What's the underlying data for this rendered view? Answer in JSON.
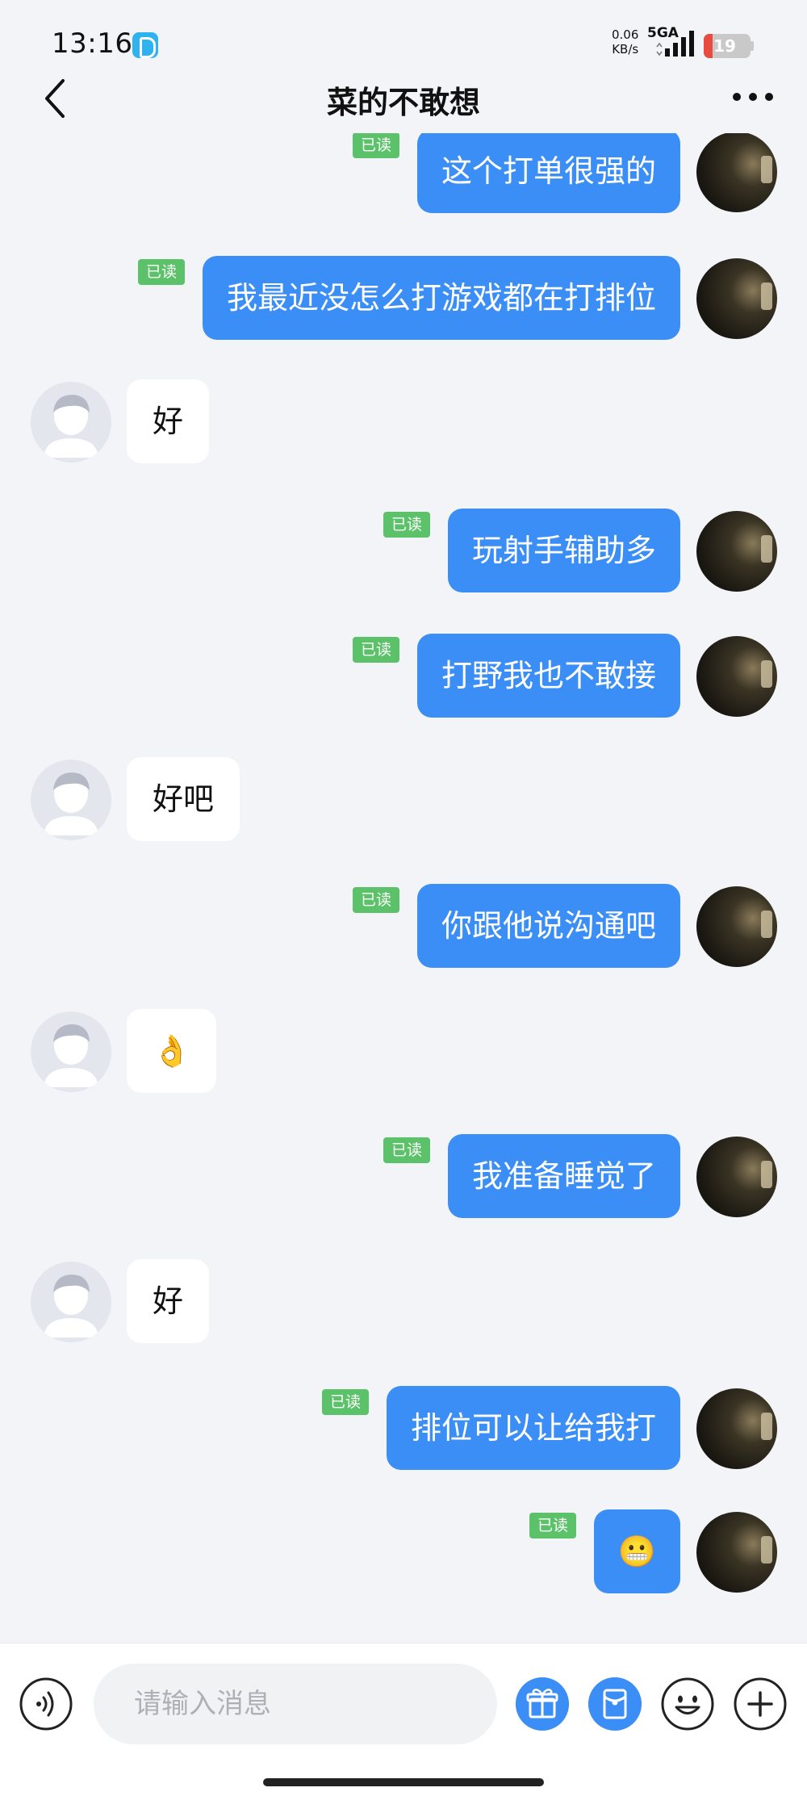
{
  "status_bar": {
    "time": "13:16",
    "net_speed_value": "0.06",
    "net_speed_unit": "KB/s",
    "network_type": "5GA",
    "battery_level": 19,
    "battery_label": "19",
    "battery_color": "#e84b40"
  },
  "header": {
    "title": "菜的不敢想",
    "back_icon": "chevron-left-icon",
    "more_icon": "more-dots-icon"
  },
  "read_label": "已读",
  "messages": [
    {
      "side": "me",
      "text": "这个打单很强的",
      "read": true
    },
    {
      "side": "me",
      "text": "我最近没怎么打游戏都在打排位",
      "read": true
    },
    {
      "side": "other",
      "text": "好"
    },
    {
      "side": "me",
      "text": "玩射手辅助多",
      "read": true
    },
    {
      "side": "me",
      "text": "打野我也不敢接",
      "read": true
    },
    {
      "side": "other",
      "text": "好吧"
    },
    {
      "side": "me",
      "text": "你跟他说沟通吧",
      "read": true
    },
    {
      "side": "other",
      "text": "👌"
    },
    {
      "side": "me",
      "text": "我准备睡觉了",
      "read": true
    },
    {
      "side": "other",
      "text": "好"
    },
    {
      "side": "me",
      "text": "排位可以让给我打",
      "read": true
    },
    {
      "side": "me",
      "text": "😬",
      "read": true
    }
  ],
  "input_bar": {
    "placeholder": "请输入消息",
    "icons": [
      "voice-icon",
      "gift-icon",
      "red-packet-icon",
      "emoji-icon",
      "plus-icon"
    ]
  },
  "colors": {
    "my_bubble": "#3a8ef5",
    "other_bubble": "#ffffff",
    "read_badge": "#5cc26a",
    "background": "#f3f4f8"
  }
}
